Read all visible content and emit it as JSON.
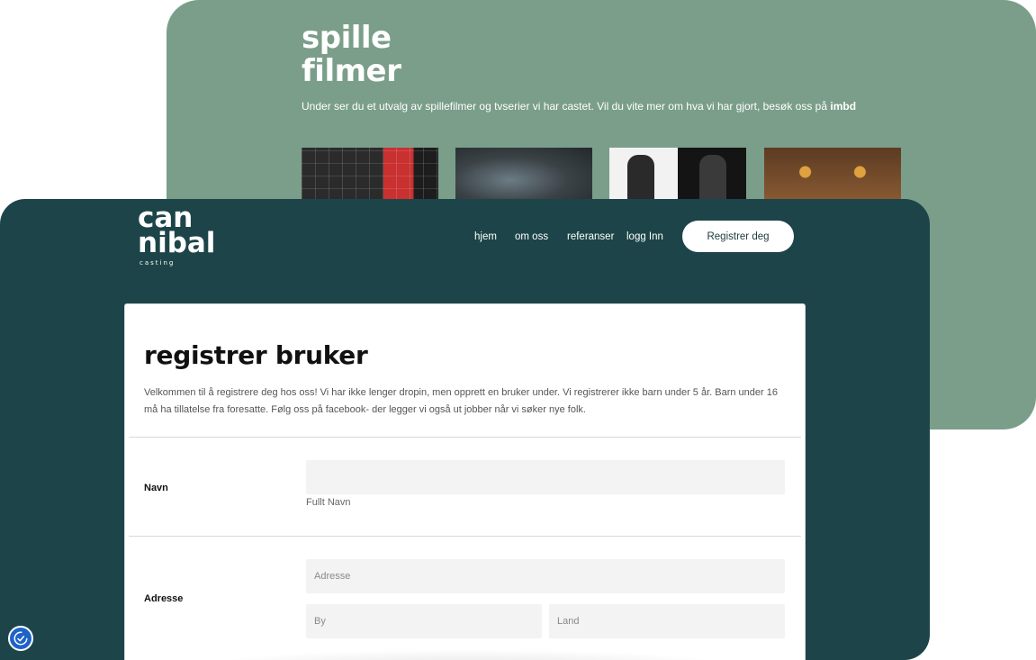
{
  "back": {
    "title_line1": "spille",
    "title_line2": "filmer",
    "intro_text": "Under ser du et utvalg av spillefilmer og tvserier vi har castet. Vil du vite mer om hva vi har gjort, besøk oss på",
    "intro_link": "imbd"
  },
  "header": {
    "logo_line1": "can",
    "logo_line2": "nibal",
    "logo_line3": "casting",
    "nav": [
      "hjem",
      "om oss",
      "referanser",
      "logg Inn"
    ],
    "cta_label": "Registrer deg"
  },
  "form": {
    "title": "registrer bruker",
    "intro": "Velkommen til å registrere deg hos oss! Vi har ikke lenger dropin, men opprett en bruker under. Vi registrerer ikke barn under 5 år. Barn under 16 må ha tillatelse fra foresatte. Følg oss på facebook- der legger vi også ut jobber når vi søker nye folk.",
    "name_label": "Navn",
    "name_hint": "Fullt Navn",
    "name_value": "",
    "address_label": "Adresse",
    "address_placeholder": "Adresse",
    "city_placeholder": "By",
    "country_placeholder": "Land"
  },
  "colors": {
    "back_card": "#7a9e8a",
    "front_card": "#1d4549",
    "accessibility": "#1e63c9"
  }
}
